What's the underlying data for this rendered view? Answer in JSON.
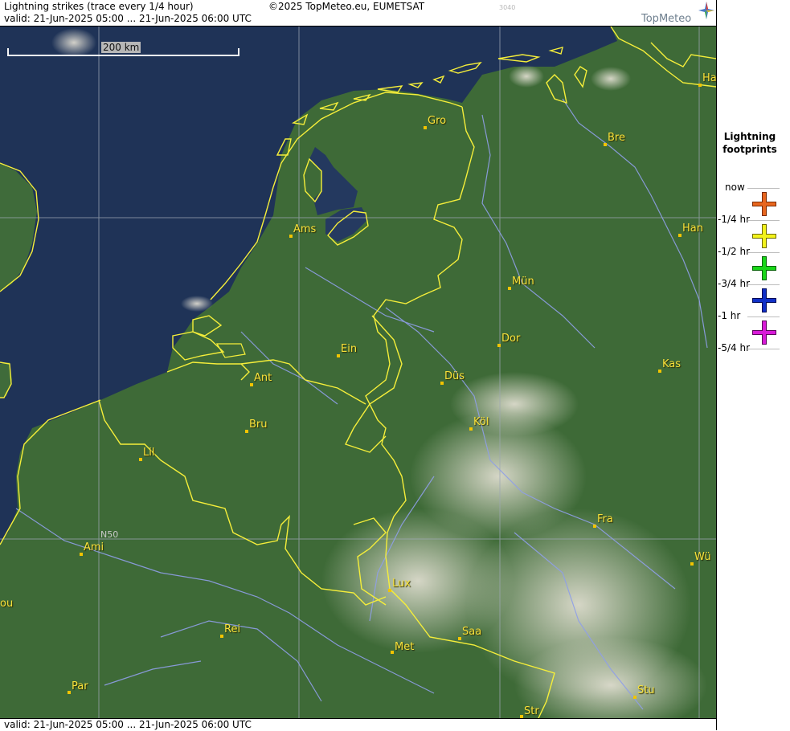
{
  "header": {
    "title": "Lightning strikes (trace every 1/4 hour)",
    "valid": "valid:  21-Jun-2025 05:00 ... 21-Jun-2025 06:00 UTC",
    "copyright": "©2025 TopMeteo.eu, EUMETSAT",
    "code": "3040",
    "logo": "TopMeteo"
  },
  "footer": {
    "valid": "valid:  21-Jun-2025 05:00 ... 21-Jun-2025 06:00 UTC"
  },
  "map": {
    "scale_label": "200 km",
    "lat_label": "N50",
    "cities": [
      {
        "name": "Gro"
      },
      {
        "name": "Bre"
      },
      {
        "name": "Ha"
      },
      {
        "name": "Ams"
      },
      {
        "name": "Han"
      },
      {
        "name": "Mün"
      },
      {
        "name": "Dor"
      },
      {
        "name": "Ein"
      },
      {
        "name": "Ant"
      },
      {
        "name": "Düs"
      },
      {
        "name": "Kas"
      },
      {
        "name": "Bru"
      },
      {
        "name": "Köl"
      },
      {
        "name": "Lil"
      },
      {
        "name": "Fra"
      },
      {
        "name": "Ami"
      },
      {
        "name": "Wü"
      },
      {
        "name": "Lux"
      },
      {
        "name": "ou"
      },
      {
        "name": "Rei"
      },
      {
        "name": "Saa"
      },
      {
        "name": "Met"
      },
      {
        "name": "Par"
      },
      {
        "name": "Stu"
      },
      {
        "name": "Str"
      }
    ]
  },
  "legend": {
    "title_line1": "Lightning",
    "title_line2": "footprints",
    "entries": [
      {
        "label": "now",
        "color": "#e8661e"
      },
      {
        "label": "-1/4 hr",
        "color": "#f2f21a"
      },
      {
        "label": "-1/2 hr",
        "color": "#19d619"
      },
      {
        "label": "-3/4 hr",
        "color": "#1030c8"
      },
      {
        "label": "-1 hr",
        "color": "#d81ad8"
      },
      {
        "label": "-5/4 hr",
        "color": ""
      }
    ]
  },
  "colors": {
    "border": "#f5ee3a",
    "water": "#1f3357",
    "land": "#3e6a37",
    "rivers": "#8f9fe8"
  }
}
